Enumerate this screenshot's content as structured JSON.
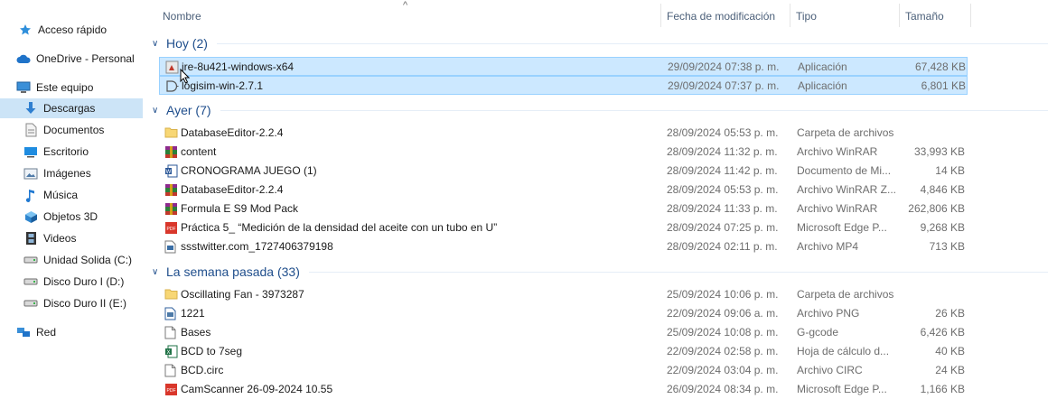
{
  "nav": {
    "items": [
      {
        "label": "Acceso rápido",
        "icon": "star-icon",
        "selected": false
      },
      {
        "label": "OneDrive - Personal",
        "icon": "cloud-icon",
        "selected": false
      },
      {
        "label": "Este equipo",
        "icon": "computer-icon",
        "selected": false
      },
      {
        "label": "Descargas",
        "icon": "download-arrow-icon",
        "selected": true
      },
      {
        "label": "Documentos",
        "icon": "document-icon",
        "selected": false
      },
      {
        "label": "Escritorio",
        "icon": "desktop-icon",
        "selected": false
      },
      {
        "label": "Imágenes",
        "icon": "image-icon",
        "selected": false
      },
      {
        "label": "Música",
        "icon": "music-note-icon",
        "selected": false
      },
      {
        "label": "Objetos 3D",
        "icon": "cube-icon",
        "selected": false
      },
      {
        "label": "Videos",
        "icon": "film-icon",
        "selected": false
      },
      {
        "label": "Unidad Solida (C:)",
        "icon": "drive-icon",
        "selected": false
      },
      {
        "label": "Disco Duro I (D:)",
        "icon": "drive-icon",
        "selected": false
      },
      {
        "label": "Disco Duro II (E:)",
        "icon": "drive-icon",
        "selected": false
      },
      {
        "label": "Red",
        "icon": "network-icon",
        "selected": false
      }
    ]
  },
  "columns": {
    "name": "Nombre",
    "date": "Fecha de modificación",
    "type": "Tipo",
    "size": "Tamaño",
    "sort_glyph": "^"
  },
  "groups": [
    {
      "label": "Hoy (2)",
      "files": [
        {
          "name": "jre-8u421-windows-x64",
          "date": "29/09/2024 07:38 p. m.",
          "type": "Aplicación",
          "size": "67,428 KB",
          "icon": "installer-icon",
          "selected": true
        },
        {
          "name": "logisim-win-2.7.1",
          "date": "29/09/2024 07:37 p. m.",
          "type": "Aplicación",
          "size": "6,801 KB",
          "icon": "logic-gate-icon",
          "selected": true
        }
      ]
    },
    {
      "label": "Ayer (7)",
      "files": [
        {
          "name": "DatabaseEditor-2.2.4",
          "date": "28/09/2024 05:53 p. m.",
          "type": "Carpeta de archivos",
          "size": "",
          "icon": "folder-icon",
          "selected": false
        },
        {
          "name": "content",
          "date": "28/09/2024 11:32 p. m.",
          "type": "Archivo WinRAR",
          "size": "33,993 KB",
          "icon": "winrar-icon",
          "selected": false
        },
        {
          "name": "CRONOGRAMA JUEGO (1)",
          "date": "28/09/2024 11:42 p. m.",
          "type": "Documento de Mi...",
          "size": "14 KB",
          "icon": "word-doc-icon",
          "selected": false
        },
        {
          "name": "DatabaseEditor-2.2.4",
          "date": "28/09/2024 05:53 p. m.",
          "type": "Archivo WinRAR Z...",
          "size": "4,846 KB",
          "icon": "winrar-icon",
          "selected": false
        },
        {
          "name": "Formula E S9 Mod Pack",
          "date": "28/09/2024 11:33 p. m.",
          "type": "Archivo WinRAR",
          "size": "262,806 KB",
          "icon": "winrar-icon",
          "selected": false
        },
        {
          "name": "Práctica 5_ “Medición de la densidad del aceite con un tubo en U”",
          "date": "28/09/2024 07:25 p. m.",
          "type": "Microsoft Edge P...",
          "size": "9,268 KB",
          "icon": "pdf-icon",
          "selected": false
        },
        {
          "name": "ssstwitter.com_1727406379198",
          "date": "28/09/2024 02:11 p. m.",
          "type": "Archivo MP4",
          "size": "713 KB",
          "icon": "video-file-icon",
          "selected": false
        }
      ]
    },
    {
      "label": "La semana pasada (33)",
      "files": [
        {
          "name": "Oscillating Fan - 3973287",
          "date": "25/09/2024 10:06 p. m.",
          "type": "Carpeta de archivos",
          "size": "",
          "icon": "folder-icon",
          "selected": false
        },
        {
          "name": "1221",
          "date": "22/09/2024 09:06 a. m.",
          "type": "Archivo PNG",
          "size": "26 KB",
          "icon": "image-file-icon",
          "selected": false
        },
        {
          "name": "Bases",
          "date": "25/09/2024 10:08 p. m.",
          "type": "G-gcode",
          "size": "6,426 KB",
          "icon": "blank-file-icon",
          "selected": false
        },
        {
          "name": "BCD to 7seg",
          "date": "22/09/2024 02:58 p. m.",
          "type": "Hoja de cálculo d...",
          "size": "40 KB",
          "icon": "excel-icon",
          "selected": false
        },
        {
          "name": "BCD.circ",
          "date": "22/09/2024 03:04 p. m.",
          "type": "Archivo CIRC",
          "size": "24 KB",
          "icon": "blank-file-icon",
          "selected": false
        },
        {
          "name": "CamScanner 26-09-2024 10.55",
          "date": "26/09/2024 08:34 p. m.",
          "type": "Microsoft Edge P...",
          "size": "1,166 KB",
          "icon": "pdf-icon",
          "selected": false
        }
      ]
    }
  ]
}
